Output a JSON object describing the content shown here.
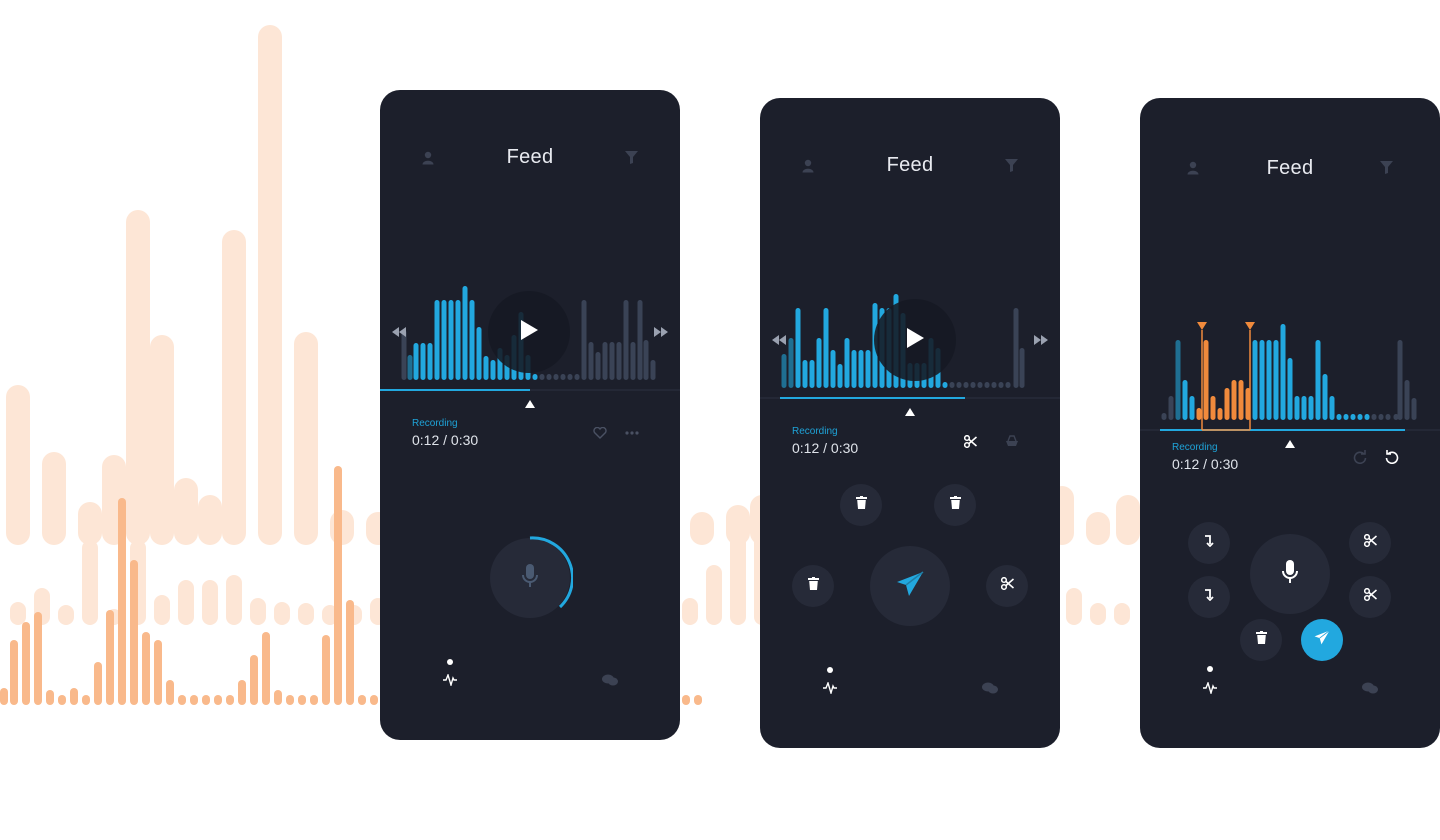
{
  "colors": {
    "accent": "#22a8df",
    "accent_dim": "#1f6f92",
    "muted_bar": "#3a4356",
    "panel": "#1c1f2b",
    "button": "#262a38",
    "trim": "#f08a3c",
    "bg_peach_light": "#fde6d6",
    "bg_peach": "#f9b98b"
  },
  "screens": [
    {
      "title": "Feed",
      "recording_label": "Recording",
      "recording_time": "0:12 / 0:30",
      "icons": [
        "user-icon",
        "filter-icon",
        "rewind-icon",
        "fast-forward-icon",
        "play-icon",
        "heart-icon",
        "more-icon",
        "mic-icon",
        "waveform-tab-icon",
        "chat-tab-icon"
      ]
    },
    {
      "title": "Feed",
      "recording_label": "Recording",
      "recording_time": "0:12 / 0:30",
      "icons": [
        "user-icon",
        "filter-icon",
        "rewind-icon",
        "fast-forward-icon",
        "play-icon",
        "scissors-icon",
        "eraser-icon",
        "trash-icon",
        "send-icon",
        "waveform-tab-icon",
        "chat-tab-icon"
      ]
    },
    {
      "title": "Feed",
      "recording_label": "Recording",
      "recording_time": "0:12 / 0:30",
      "icons": [
        "user-icon",
        "filter-icon",
        "redo-icon",
        "undo-icon",
        "mic-icon",
        "insert-icon",
        "scissors-icon",
        "trash-icon",
        "send-icon",
        "waveform-tab-icon",
        "chat-tab-icon"
      ]
    }
  ]
}
